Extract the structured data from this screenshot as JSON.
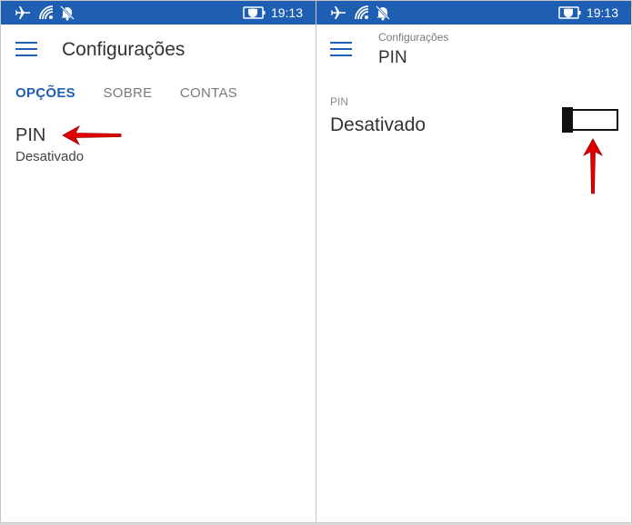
{
  "status_bar": {
    "time": "19:13",
    "icons": [
      "airplane-icon",
      "wifi-icon",
      "alarm-off-icon",
      "battery-saver-icon"
    ]
  },
  "left_screen": {
    "title": "Configurações",
    "tabs": [
      {
        "label": "OPÇÕES",
        "active": true
      },
      {
        "label": "SOBRE",
        "active": false
      },
      {
        "label": "CONTAS",
        "active": false
      }
    ],
    "item": {
      "title": "PIN",
      "subtitle": "Desativado"
    }
  },
  "right_screen": {
    "breadcrumb": "Configurações",
    "title": "PIN",
    "setting_label": "PIN",
    "setting_value": "Desativado",
    "toggle_state": "off"
  },
  "colors": {
    "accent": "#1e5fb4",
    "annotation_arrow": "#e00000",
    "background": "#ffffff"
  }
}
